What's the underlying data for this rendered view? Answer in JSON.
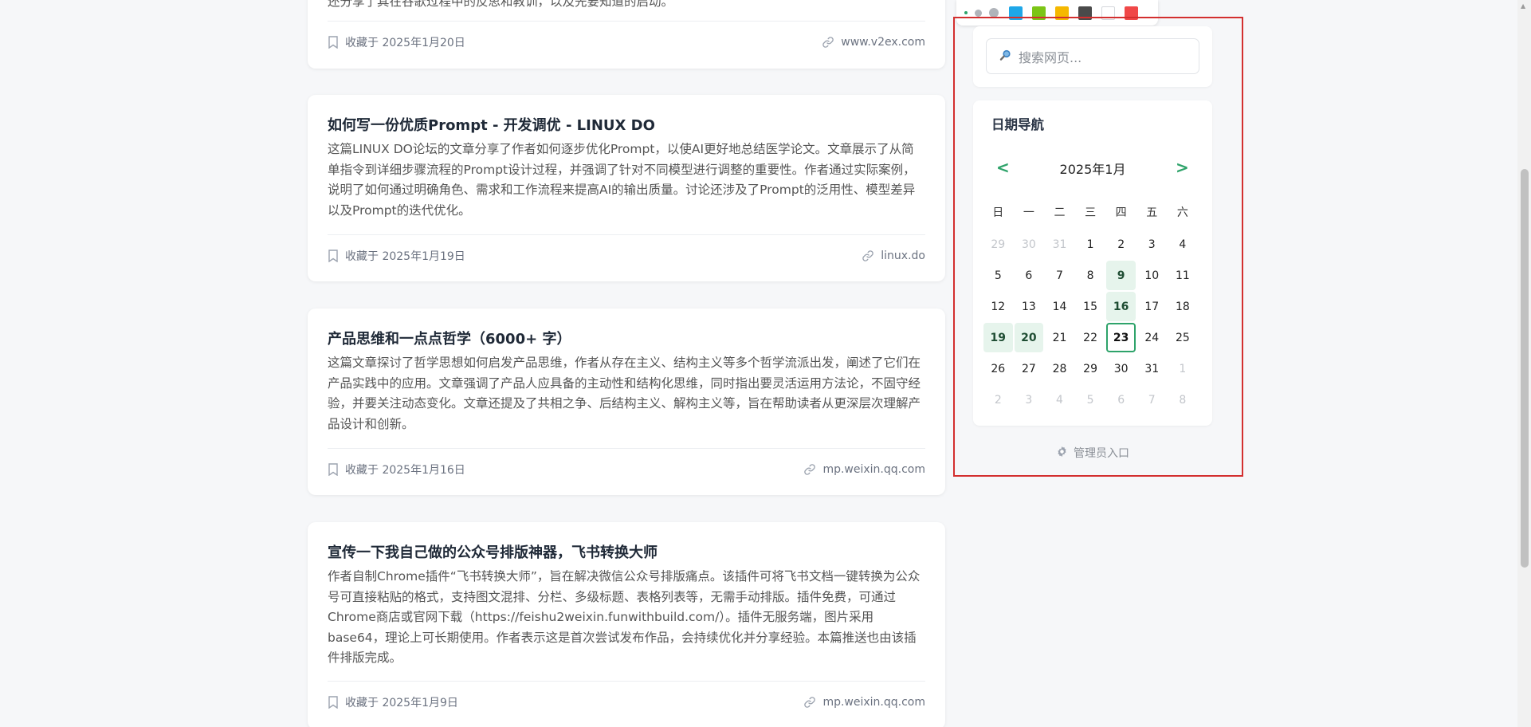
{
  "feed": {
    "partial_card": {
      "summary_tail": "还分享了其在谷歌过程中的反思和教训，以及先要知道的启动。",
      "saved_label": "收藏于 2025年1月20日",
      "domain": "www.v2ex.com"
    },
    "cards": [
      {
        "title": "如何写一份优质Prompt - 开发调优 - LINUX DO",
        "summary": "这篇LINUX DO论坛的文章分享了作者如何逐步优化Prompt，以使AI更好地总结医学论文。文章展示了从简单指令到详细步骤流程的Prompt设计过程，并强调了针对不同模型进行调整的重要性。作者通过实际案例，说明了如何通过明确角色、需求和工作流程来提高AI的输出质量。讨论还涉及了Prompt的泛用性、模型差异以及Prompt的迭代优化。",
        "saved_label": "收藏于 2025年1月19日",
        "domain": "linux.do"
      },
      {
        "title": "产品思维和一点点哲学（6000+ 字）",
        "summary": "这篇文章探讨了哲学思想如何启发产品思维，作者从存在主义、结构主义等多个哲学流派出发，阐述了它们在产品实践中的应用。文章强调了产品人应具备的主动性和结构化思维，同时指出要灵活运用方法论，不固守经验，并要关注动态变化。文章还提及了共相之争、后结构主义、解构主义等，旨在帮助读者从更深层次理解产品设计和创新。",
        "saved_label": "收藏于 2025年1月16日",
        "domain": "mp.weixin.qq.com"
      },
      {
        "title": "宣传一下我自己做的公众号排版神器，飞书转换大师",
        "summary": "作者自制Chrome插件“飞书转换大师”，旨在解决微信公众号排版痛点。该插件可将飞书文档一键转换为公众号可直接粘贴的格式，支持图文混排、分栏、多级标题、表格列表等，无需手动排版。插件免费，可通过Chrome商店或官网下载（https://feishu2weixin.funwithbuild.com/）。插件无服务端，图片采用base64，理论上可长期使用。作者表示这是首次尝试发布作品，会持续优化并分享经验。本篇推送也由该插件排版完成。",
        "saved_label": "收藏于 2025年1月9日",
        "domain": "mp.weixin.qq.com"
      }
    ]
  },
  "toolbar": {
    "swatches": [
      "#1ea7e8",
      "#7cc516",
      "#f5b800",
      "#4a4a4a",
      "#ffffff",
      "#f04848"
    ]
  },
  "search": {
    "placeholder": "搜索网页..."
  },
  "calendar": {
    "title": "日期导航",
    "prev": "<",
    "next": ">",
    "month_label": "2025年1月",
    "weekdays": [
      "日",
      "一",
      "二",
      "三",
      "四",
      "五",
      "六"
    ],
    "days": [
      {
        "d": "29",
        "s": "muted"
      },
      {
        "d": "30",
        "s": "muted"
      },
      {
        "d": "31",
        "s": "muted"
      },
      {
        "d": "1",
        "s": ""
      },
      {
        "d": "2",
        "s": ""
      },
      {
        "d": "3",
        "s": ""
      },
      {
        "d": "4",
        "s": ""
      },
      {
        "d": "5",
        "s": ""
      },
      {
        "d": "6",
        "s": ""
      },
      {
        "d": "7",
        "s": ""
      },
      {
        "d": "8",
        "s": ""
      },
      {
        "d": "9",
        "s": "has"
      },
      {
        "d": "10",
        "s": ""
      },
      {
        "d": "11",
        "s": ""
      },
      {
        "d": "12",
        "s": ""
      },
      {
        "d": "13",
        "s": ""
      },
      {
        "d": "14",
        "s": ""
      },
      {
        "d": "15",
        "s": ""
      },
      {
        "d": "16",
        "s": "has"
      },
      {
        "d": "17",
        "s": ""
      },
      {
        "d": "18",
        "s": ""
      },
      {
        "d": "19",
        "s": "has"
      },
      {
        "d": "20",
        "s": "has"
      },
      {
        "d": "21",
        "s": ""
      },
      {
        "d": "22",
        "s": ""
      },
      {
        "d": "23",
        "s": "today"
      },
      {
        "d": "24",
        "s": ""
      },
      {
        "d": "25",
        "s": ""
      },
      {
        "d": "26",
        "s": ""
      },
      {
        "d": "27",
        "s": ""
      },
      {
        "d": "28",
        "s": ""
      },
      {
        "d": "29",
        "s": ""
      },
      {
        "d": "30",
        "s": ""
      },
      {
        "d": "31",
        "s": ""
      },
      {
        "d": "1",
        "s": "muted"
      },
      {
        "d": "2",
        "s": "muted"
      },
      {
        "d": "3",
        "s": "muted"
      },
      {
        "d": "4",
        "s": "muted"
      },
      {
        "d": "5",
        "s": "muted"
      },
      {
        "d": "6",
        "s": "muted"
      },
      {
        "d": "7",
        "s": "muted"
      },
      {
        "d": "8",
        "s": "muted"
      }
    ]
  },
  "admin": {
    "label": "管理员入口"
  }
}
